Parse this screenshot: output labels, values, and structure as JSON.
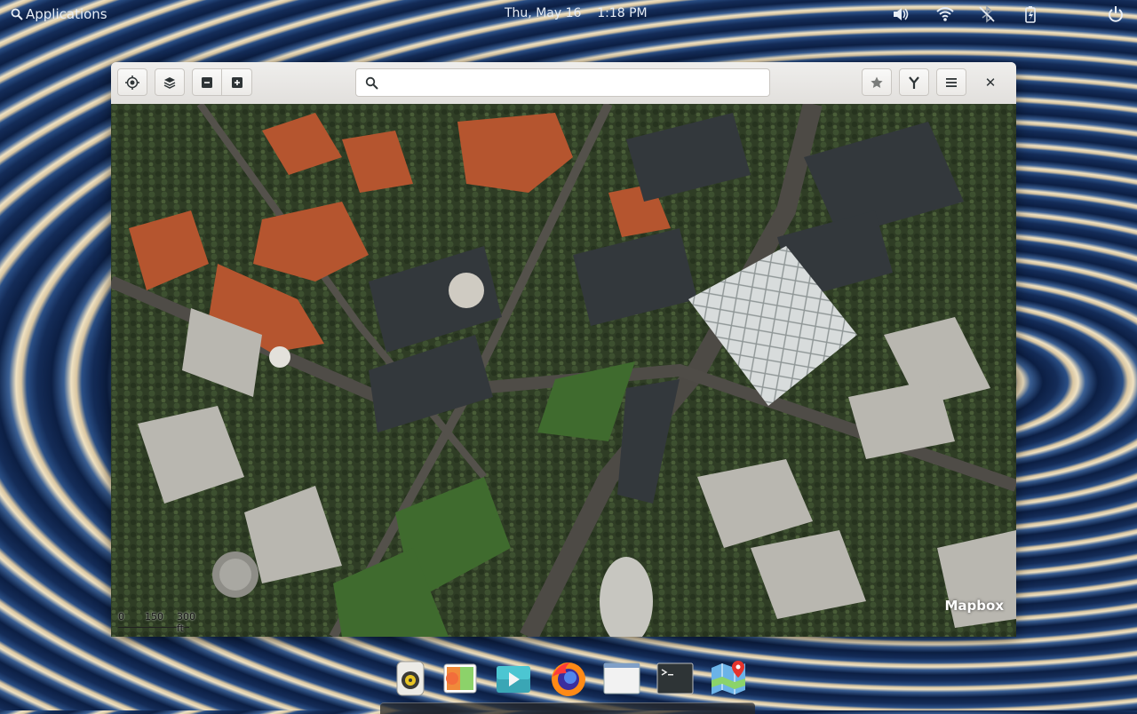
{
  "topbar": {
    "applications_label": "Applications",
    "datetime": "Thu, May 16    1:18 PM",
    "icons": [
      "volume-icon",
      "wifi-icon",
      "bluetooth-off-icon",
      "battery-icon",
      "power-icon"
    ]
  },
  "window": {
    "toolbar_icons": [
      "locate-icon",
      "layers-icon",
      "zoom-out-icon",
      "zoom-in-icon",
      "star-icon",
      "route-icon",
      "menu-icon",
      "close-icon"
    ],
    "search": {
      "value": "",
      "placeholder": ""
    },
    "close_label": "✕"
  },
  "map": {
    "provider_label": "Mapbox",
    "attribution": "© Mapbox © OpenStreetMap",
    "scale": {
      "zero": "0",
      "mid": "150",
      "max": "300 ft"
    },
    "style": "satellite"
  },
  "dock": {
    "apps": [
      "rhythmbox-icon",
      "photos-icon",
      "videos-icon",
      "firefox-icon",
      "files-window-icon",
      "terminal-icon",
      "maps-icon"
    ]
  },
  "colors": {
    "accent": "#3584e4",
    "header_bg": "#e9e8e6",
    "topbar_text": "#e8eef6"
  }
}
